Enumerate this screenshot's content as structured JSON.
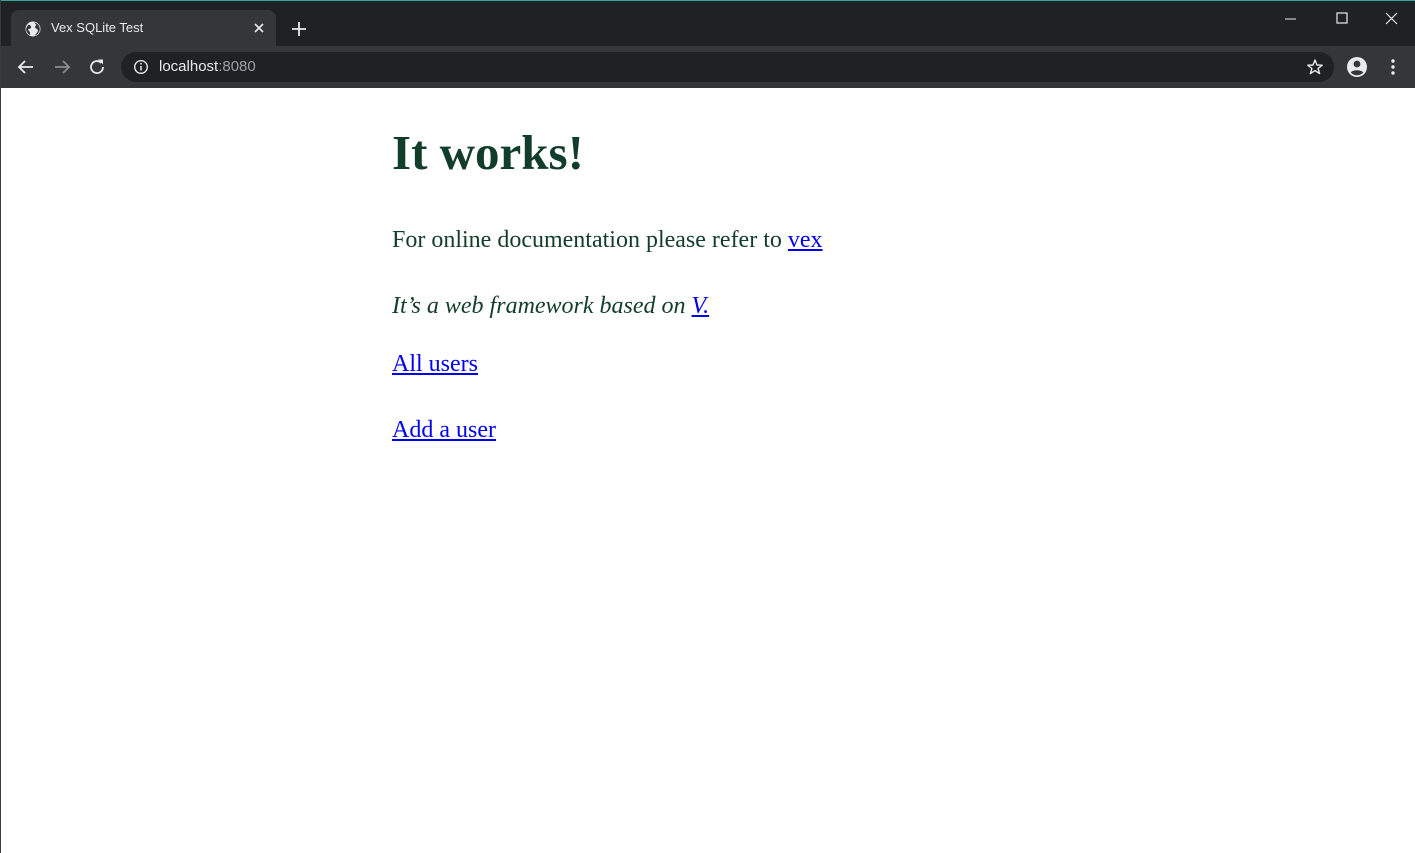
{
  "browser": {
    "tab_title": "Vex SQLite Test",
    "url_host": "localhost",
    "url_port": ":8080",
    "icons": {
      "favicon": "globe-icon",
      "tab_close": "close-icon",
      "new_tab": "plus-icon",
      "minimize": "minimize-icon",
      "maximize": "maximize-icon",
      "close_window": "close-icon",
      "back": "back-arrow-icon",
      "forward": "forward-arrow-icon",
      "reload": "reload-icon",
      "site_info": "info-icon",
      "bookmark": "star-icon",
      "profile": "account-icon",
      "menu": "more-vertical-icon"
    }
  },
  "page": {
    "heading": "It works!",
    "doc_text": "For online documentation please refer to ",
    "doc_link": "vex",
    "framework_text": "It’s a web framework based on ",
    "framework_link": "V.",
    "all_users_link": "All users",
    "add_user_link": "Add a user"
  },
  "colors": {
    "text": "#133d2b",
    "link": "#0000ee",
    "tabstrip_bg": "#202124",
    "toolbar_bg": "#35363a"
  }
}
